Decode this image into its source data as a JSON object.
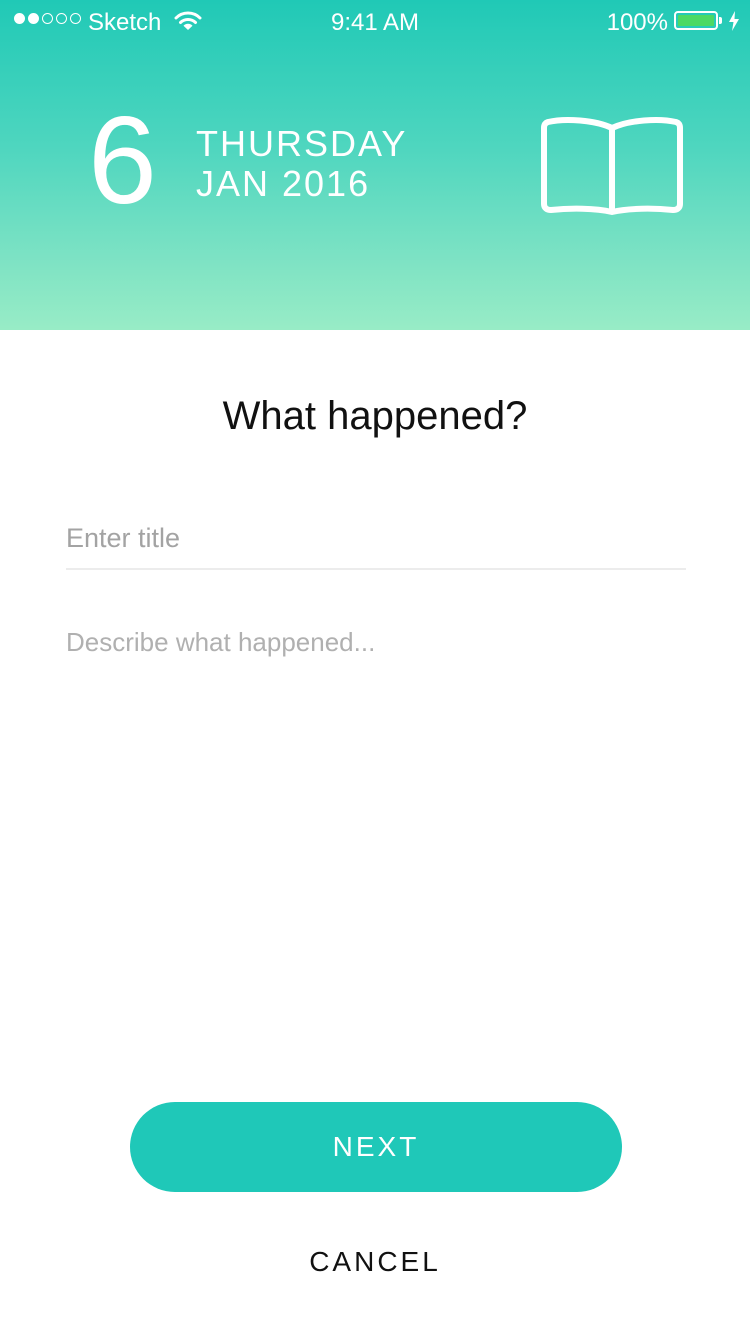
{
  "status_bar": {
    "carrier": "Sketch",
    "time": "9:41 AM",
    "battery_percent": "100%",
    "signal_strength": 2,
    "signal_max": 5,
    "icons": [
      "signal-dots-icon",
      "wifi-icon",
      "battery-icon",
      "charging-bolt-icon"
    ],
    "battery_color": "#4cd964"
  },
  "header": {
    "day_number": "6",
    "weekday": "THURSDAY",
    "month_year": "JAN 2016",
    "icon": "open-book-icon",
    "gradient_top": "#20c9b6",
    "gradient_bottom": "#98ecc6"
  },
  "form": {
    "prompt": "What happened?",
    "title_placeholder": "Enter title",
    "title_value": "",
    "description_placeholder": "Describe what happened...",
    "description_value": ""
  },
  "actions": {
    "next_label": "NEXT",
    "cancel_label": "CANCEL",
    "accent_color": "#1fc8b8"
  }
}
